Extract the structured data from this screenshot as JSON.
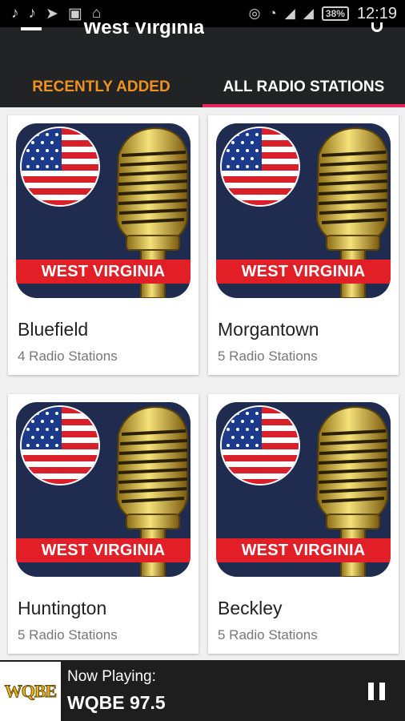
{
  "status_bar": {
    "left_icons": [
      "music-note-icon",
      "music-note-icon",
      "send-icon",
      "image-icon",
      "broom-icon"
    ],
    "right_icons": [
      "sync-icon",
      "wifi-icon",
      "signal-icon",
      "signal-icon"
    ],
    "battery": "38%",
    "time": "12:19"
  },
  "app_bar": {
    "title": "West Virginia",
    "tabs": [
      {
        "label": "RECENTLY ADDED",
        "active": true
      },
      {
        "label": "ALL RADIO STATIONS",
        "active": false
      }
    ]
  },
  "cards": [
    {
      "banner": "WEST VIRGINIA",
      "city": "Bluefield",
      "count": "4 Radio Stations"
    },
    {
      "banner": "WEST VIRGINIA",
      "city": "Morgantown",
      "count": "5 Radio Stations"
    },
    {
      "banner": "WEST VIRGINIA",
      "city": "Huntington",
      "count": "5 Radio Stations"
    },
    {
      "banner": "WEST VIRGINIA",
      "city": "Beckley",
      "count": "5 Radio Stations"
    }
  ],
  "player": {
    "logo_text": "WQBE",
    "label": "Now Playing:",
    "station": "WQBE 97.5"
  },
  "colors": {
    "accent_orange": "#f0921e",
    "indicator_pink": "#e8265a",
    "banner_red": "#e21f26",
    "app_bar": "#222325"
  }
}
